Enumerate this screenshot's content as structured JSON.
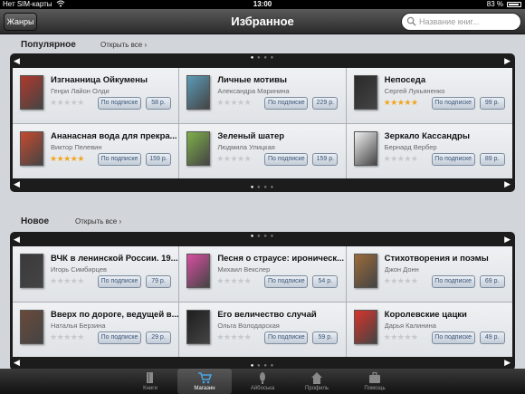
{
  "status_bar": {
    "carrier": "Нет SIM-карты",
    "time": "13:00",
    "battery": "83 %"
  },
  "nav": {
    "genres_label": "Жанры",
    "title": "Избранное",
    "search_placeholder": "Название книг..."
  },
  "sections": [
    {
      "title": "Популярное",
      "open_all": "Открыть все ›",
      "books": [
        {
          "title": "Изгнанница Ойкумены",
          "author": "Генри Лайон Олди",
          "rating": 0,
          "subscribe": "По подписке",
          "price": "58 р.",
          "cover_color": "#b0392c"
        },
        {
          "title": "Личные мотивы",
          "author": "Александра Маринина",
          "rating": 0,
          "subscribe": "По подписке",
          "price": "229 р.",
          "cover_color": "#5c9bb8"
        },
        {
          "title": "Непоседа",
          "author": "Сергей Лукьяненко",
          "rating": 5,
          "subscribe": "По подписке",
          "price": "99 р.",
          "cover_color": "#2a2a2a"
        },
        {
          "title": "Ананасная вода для прекра...",
          "author": "Виктор Пелевин",
          "rating": 5,
          "subscribe": "По подписке",
          "price": "159 р.",
          "cover_color": "#c64a2e"
        },
        {
          "title": "Зеленый шатер",
          "author": "Людмила Улицкая",
          "rating": 0,
          "subscribe": "По подписке",
          "price": "159 р.",
          "cover_color": "#7fb04a"
        },
        {
          "title": "Зеркало Кассандры",
          "author": "Бернард Вербер",
          "rating": 0,
          "subscribe": "По подписке",
          "price": "89 р.",
          "cover_color": "#f0f0f0"
        }
      ]
    },
    {
      "title": "Новое",
      "open_all": "Открыть все ›",
      "books": [
        {
          "title": "ВЧК в ленинской России. 19...",
          "author": "Игорь Симбирцев",
          "rating": 0,
          "subscribe": "По подписке",
          "price": "79 р.",
          "cover_color": "#3a3a3a"
        },
        {
          "title": "Песня о страусе: ироническ...",
          "author": "Михаил Векслер",
          "rating": 0,
          "subscribe": "По подписке",
          "price": "54 р.",
          "cover_color": "#d84fa2"
        },
        {
          "title": "Стихотворения и поэмы",
          "author": "Джон Донн",
          "rating": 0,
          "subscribe": "По подписке",
          "price": "69 р.",
          "cover_color": "#9b6b3a"
        },
        {
          "title": "Вверх по дороге, ведущей в...",
          "author": "Наталья Берзина",
          "rating": 0,
          "subscribe": "По подписке",
          "price": "29 р.",
          "cover_color": "#6a4a3a"
        },
        {
          "title": "Его величество случай",
          "author": "Ольга Володарская",
          "rating": 0,
          "subscribe": "По подписке",
          "price": "59 р.",
          "cover_color": "#1e1e1e"
        },
        {
          "title": "Королевские цацки",
          "author": "Дарья Калинина",
          "rating": 0,
          "subscribe": "По подписке",
          "price": "49 р.",
          "cover_color": "#d8332a"
        }
      ]
    }
  ],
  "tabs": [
    {
      "label": "Книги",
      "icon": "books-icon"
    },
    {
      "label": "Магазин",
      "icon": "cart-icon",
      "active": true
    },
    {
      "label": "Айбоська",
      "icon": "microphone-icon"
    },
    {
      "label": "Профиль",
      "icon": "house-icon"
    },
    {
      "label": "Помощь",
      "icon": "briefcase-icon"
    }
  ]
}
